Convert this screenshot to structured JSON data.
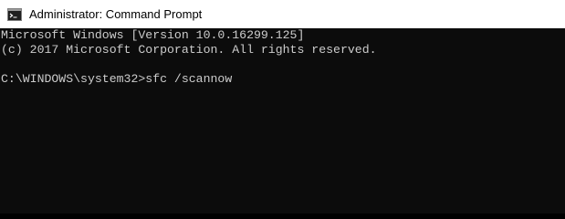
{
  "window": {
    "title": "Administrator: Command Prompt",
    "icon": "cmd-console-icon"
  },
  "console": {
    "lines": [
      "Microsoft Windows [Version 10.0.16299.125]",
      "(c) 2017 Microsoft Corporation. All rights reserved.",
      "",
      "C:\\WINDOWS\\system32>sfc /scannow"
    ]
  },
  "colors": {
    "console_background": "#0c0c0c",
    "console_text": "#cccccc",
    "titlebar_background": "#ffffff"
  }
}
